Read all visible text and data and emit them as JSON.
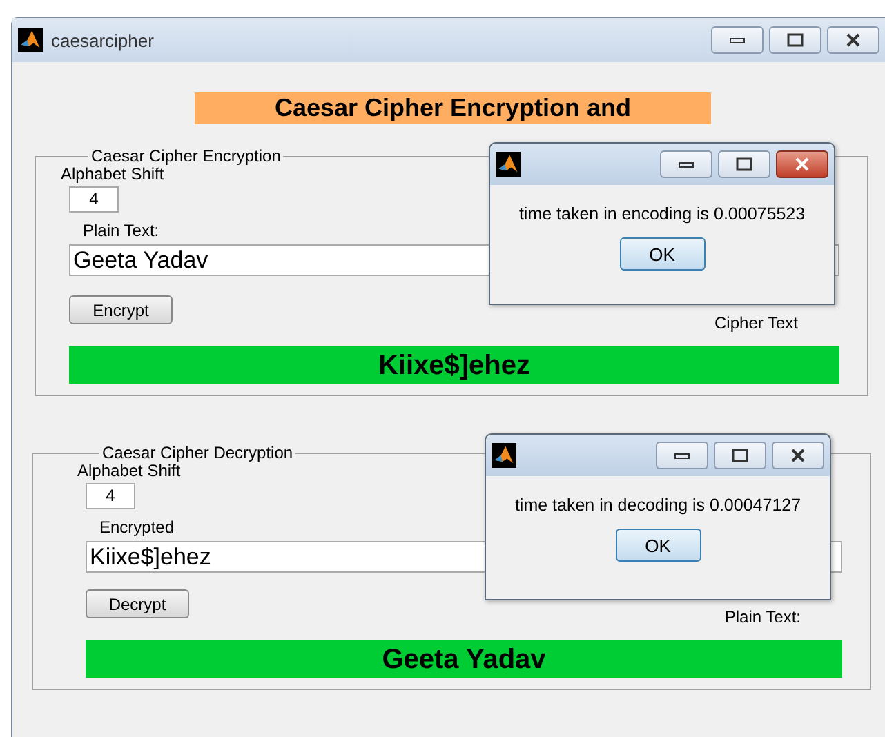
{
  "window": {
    "title": "caesarcipher"
  },
  "heading": "Caesar Cipher Encryption and",
  "panels": [
    {
      "title": "Caesar Cipher Encryption",
      "shift_label": "Alphabet Shift",
      "shift_value": "4",
      "input_label": "Plain Text:",
      "input_value": "Geeta Yadav",
      "button": "Encrypt",
      "output_label": "Cipher Text",
      "output": "Kiixe$]ehez"
    },
    {
      "title": "Caesar Cipher Decryption",
      "shift_label": "Alphabet Shift",
      "shift_value": "4",
      "input_label": "Encrypted",
      "input_value": "Kiixe$]ehez",
      "button": "Decrypt",
      "output_label": "Plain Text:",
      "output": "Geeta Yadav"
    }
  ],
  "dialogs": [
    {
      "message": "time taken in encoding is 0.00075523",
      "button": "OK",
      "active": true
    },
    {
      "message": "time taken in decoding is 0.00047127",
      "button": "OK",
      "active": false
    }
  ]
}
